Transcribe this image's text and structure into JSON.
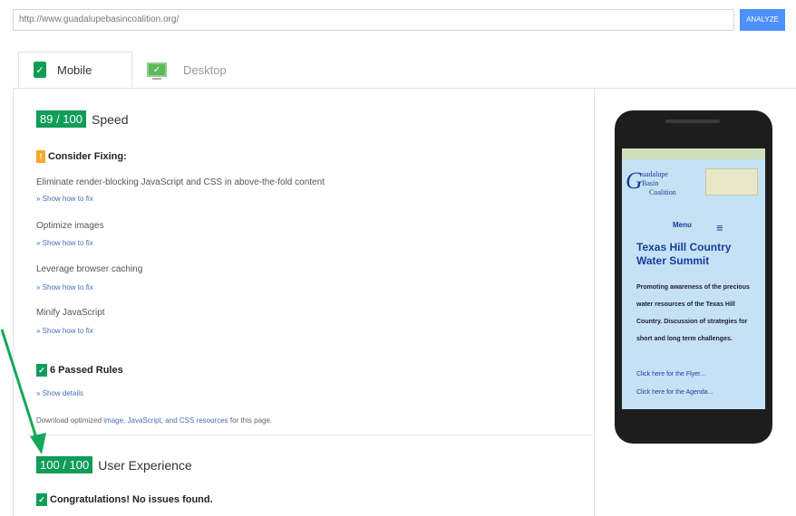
{
  "url_bar": {
    "value": "http://www.guadalupebasincoalition.org/"
  },
  "analyze_label": "ANALYZE",
  "tabs": [
    {
      "label": "Mobile"
    },
    {
      "label": "Desktop"
    }
  ],
  "speed": {
    "score": "89 / 100",
    "label": "Speed",
    "consider_fixing": "Consider Fixing:",
    "rules": [
      {
        "title": "Eliminate render-blocking JavaScript and CSS in above-the-fold content",
        "link": "» Show how to fix"
      },
      {
        "title": "Optimize images",
        "link": "» Show how to fix"
      },
      {
        "title": "Leverage browser caching",
        "link": "» Show how to fix"
      },
      {
        "title": "Minify JavaScript",
        "link": "» Show how to fix"
      }
    ],
    "passed": "6 Passed Rules",
    "show_details": "» Show details",
    "download_note": {
      "prefix": "Download optimized ",
      "link": "image, JavaScript, and CSS resources",
      "suffix": " for this page."
    }
  },
  "ux": {
    "score": "100 / 100",
    "label": "User Experience",
    "congrats": "Congratulations! No issues found."
  },
  "preview": {
    "logo_text": "Guadalupe Basin Coalition",
    "menu": "Menu",
    "title": "Texas Hill Country Water Summit",
    "body": "Promoting awareness of the precious water resources of the Texas Hill Country. Discussion of strategies for short and long term challenges.",
    "link1": "Click here for the Flyer...",
    "link2": "Click here for the Agenda..."
  },
  "colors": {
    "score_green": "#0f9d58",
    "warning": "#f9a825",
    "link": "#4a6fb5",
    "arrow": "#14a85a"
  }
}
